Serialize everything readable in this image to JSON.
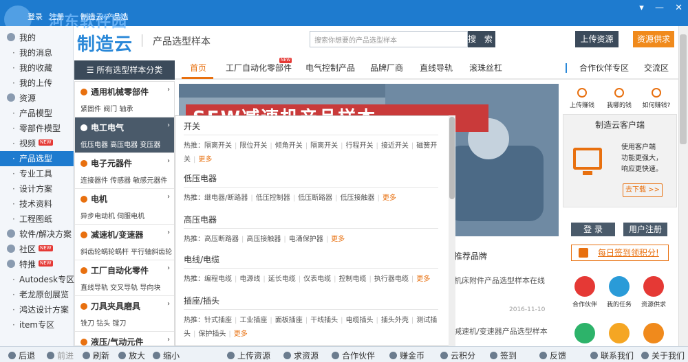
{
  "titlebar": {
    "login": "登录",
    "register": "注册",
    "hint": "制造云·产品选",
    "watermark": "河东软件园"
  },
  "header": {
    "brand": "制造云",
    "subtitle": "产品选型样本",
    "search_placeholder": "搜索你想要的产品选型样本",
    "search_btn": "搜 索",
    "upload_btn": "上传资源",
    "supply_btn": "资源供求"
  },
  "sidebar": {
    "items": [
      {
        "label": "我的",
        "type": "group"
      },
      {
        "label": "我的消息",
        "type": "sub"
      },
      {
        "label": "我的收藏",
        "type": "sub"
      },
      {
        "label": "我的上传",
        "type": "sub"
      },
      {
        "label": "资源",
        "type": "group"
      },
      {
        "label": "产品模型",
        "type": "sub"
      },
      {
        "label": "零部件模型",
        "type": "sub"
      },
      {
        "label": "视频",
        "type": "sub",
        "badge": "NEW"
      },
      {
        "label": "产品选型",
        "type": "sub",
        "active": true
      },
      {
        "label": "专业工具",
        "type": "sub"
      },
      {
        "label": "设计方案",
        "type": "sub"
      },
      {
        "label": "技术资料",
        "type": "sub"
      },
      {
        "label": "工程图纸",
        "type": "sub"
      },
      {
        "label": "软件/解决方案",
        "type": "group"
      },
      {
        "label": "社区",
        "type": "group",
        "badge": "NEW"
      },
      {
        "label": "特推",
        "type": "group",
        "badge": "NEW"
      },
      {
        "label": "Autodesk专区",
        "type": "sub"
      },
      {
        "label": "老龙原创展览",
        "type": "sub"
      },
      {
        "label": "鸿达设计方案",
        "type": "sub"
      },
      {
        "label": "item专区",
        "type": "sub"
      }
    ]
  },
  "nav": {
    "all_categories": "所有选型样本分类",
    "items": [
      "首页",
      "工厂自动化零部件",
      "电气控制产品",
      "品牌厂商",
      "直线导轨",
      "滚珠丝杠",
      "合作伙伴专区",
      "交流区"
    ],
    "new_badge": "NEW"
  },
  "categories": [
    {
      "title": "通用机械零部件",
      "sub": "紧固件 阀门 轴承"
    },
    {
      "title": "电工电气",
      "sub": "低压电器 高压电器 变压器",
      "active": true
    },
    {
      "title": "电子元器件",
      "sub": "连接器件 传感器 敏感元器件"
    },
    {
      "title": "电机",
      "sub": "异步电动机 伺服电机"
    },
    {
      "title": "减速机/变速器",
      "sub": "斜齿轮蜗轮蜗杆 平行轴斜齿轮"
    },
    {
      "title": "工厂自动化零件",
      "sub": "直线导轨 交叉导轨 导向块"
    },
    {
      "title": "刀具夹具磨具",
      "sub": "铣刀 钻头 镗刀"
    },
    {
      "title": "液压/气动元件",
      "sub": ""
    }
  ],
  "banner": {
    "title": "SEW减速机产品样本"
  },
  "dropdown": {
    "hot_label": "热推：",
    "more": "更多",
    "sections": [
      {
        "title": "开关",
        "items": [
          "隔离开关",
          "限位开关",
          "倾角开关",
          "隔离开关",
          "行程开关",
          "接近开关",
          "磁簧开关"
        ]
      },
      {
        "title": "低压电器",
        "items": [
          "继电器/断路器",
          "低压控制器",
          "低压断路器",
          "低压接触器"
        ]
      },
      {
        "title": "高压电器",
        "items": [
          "高压断路器",
          "高压接触器",
          "电涌保护器"
        ]
      },
      {
        "title": "电线/电缆",
        "items": [
          "编程电缆",
          "电源线",
          "延长电缆",
          "仪表电缆",
          "控制电缆",
          "执行器电缆"
        ]
      },
      {
        "title": "插座/插头",
        "items": [
          "针式插座",
          "工业插座",
          "面板插座",
          "干线插头",
          "电缆插头",
          "插头外壳",
          "测试插头",
          "保护插头"
        ]
      }
    ]
  },
  "news": {
    "n1": "推荐品牌",
    "n2": "机床附件产品选型样本在线",
    "n3": "2016-11-10",
    "n4": "减速机/变速器产品选型样本"
  },
  "right": {
    "top": [
      "上传赚钱",
      "我哪的钱",
      "如何赚钱?"
    ],
    "client_title": "制造云客户端",
    "client_desc": [
      "使用客户端",
      "功能更强大，",
      "响应更快速。"
    ],
    "download": "去下载 >>",
    "login": "登 录",
    "register": "用户注册",
    "signin": "每日签到领积分!",
    "circles": [
      {
        "label": "合作伙伴",
        "color": "#e53935"
      },
      {
        "label": "我的任务",
        "color": "#2a9bd8"
      },
      {
        "label": "资源供求",
        "color": "#e53935"
      },
      {
        "label": "",
        "color": "#2db36a"
      },
      {
        "label": "",
        "color": "#f5a623"
      },
      {
        "label": "",
        "color": "#f08a1c"
      }
    ]
  },
  "bottom": {
    "items": [
      {
        "label": "后退"
      },
      {
        "label": "前进",
        "dim": true
      },
      {
        "label": "刷新"
      },
      {
        "label": "放大"
      },
      {
        "label": "缩小"
      },
      {
        "label": "上传资源"
      },
      {
        "label": "求资源"
      },
      {
        "label": "合作伙伴"
      },
      {
        "label": "赚金币"
      },
      {
        "label": "云积分"
      },
      {
        "label": "签到"
      },
      {
        "label": "反馈"
      },
      {
        "label": "联系我们"
      },
      {
        "label": "关于我们"
      }
    ]
  }
}
